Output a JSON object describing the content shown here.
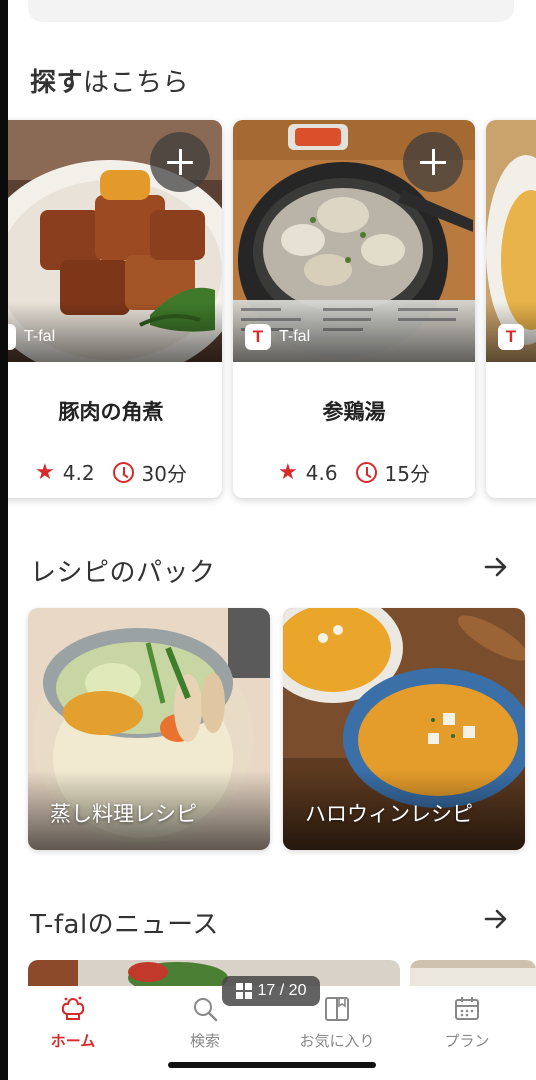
{
  "sections": {
    "search": {
      "title_bold": "探す",
      "title_rest": "はこちら"
    },
    "packs": {
      "title": "レシピのパック"
    },
    "news": {
      "title": "T-falのニュース"
    }
  },
  "recipes": [
    {
      "title": "豚肉の角煮",
      "rating": "4.2",
      "time": "30分",
      "brand": "T-fal",
      "brand_logo": "T"
    },
    {
      "title": "参鶏湯",
      "rating": "4.6",
      "time": "15分",
      "brand": "T-fal",
      "brand_logo": "T"
    },
    {
      "title": "",
      "rating": "",
      "time": "",
      "brand": "",
      "brand_logo": "T"
    }
  ],
  "packs": [
    {
      "label": "蒸し料理レシピ"
    },
    {
      "label": "ハロウィンレシピ"
    }
  ],
  "page_counter": "17 / 20",
  "tabs": [
    {
      "label": "ホーム",
      "icon": "chef-hat-icon",
      "active": true
    },
    {
      "label": "検索",
      "icon": "search-icon",
      "active": false
    },
    {
      "label": "お気に入り",
      "icon": "book-icon",
      "active": false
    },
    {
      "label": "プラン",
      "icon": "calendar-icon",
      "active": false
    }
  ],
  "colors": {
    "accent": "#d72b2b",
    "text": "#222222",
    "muted": "#888888"
  }
}
